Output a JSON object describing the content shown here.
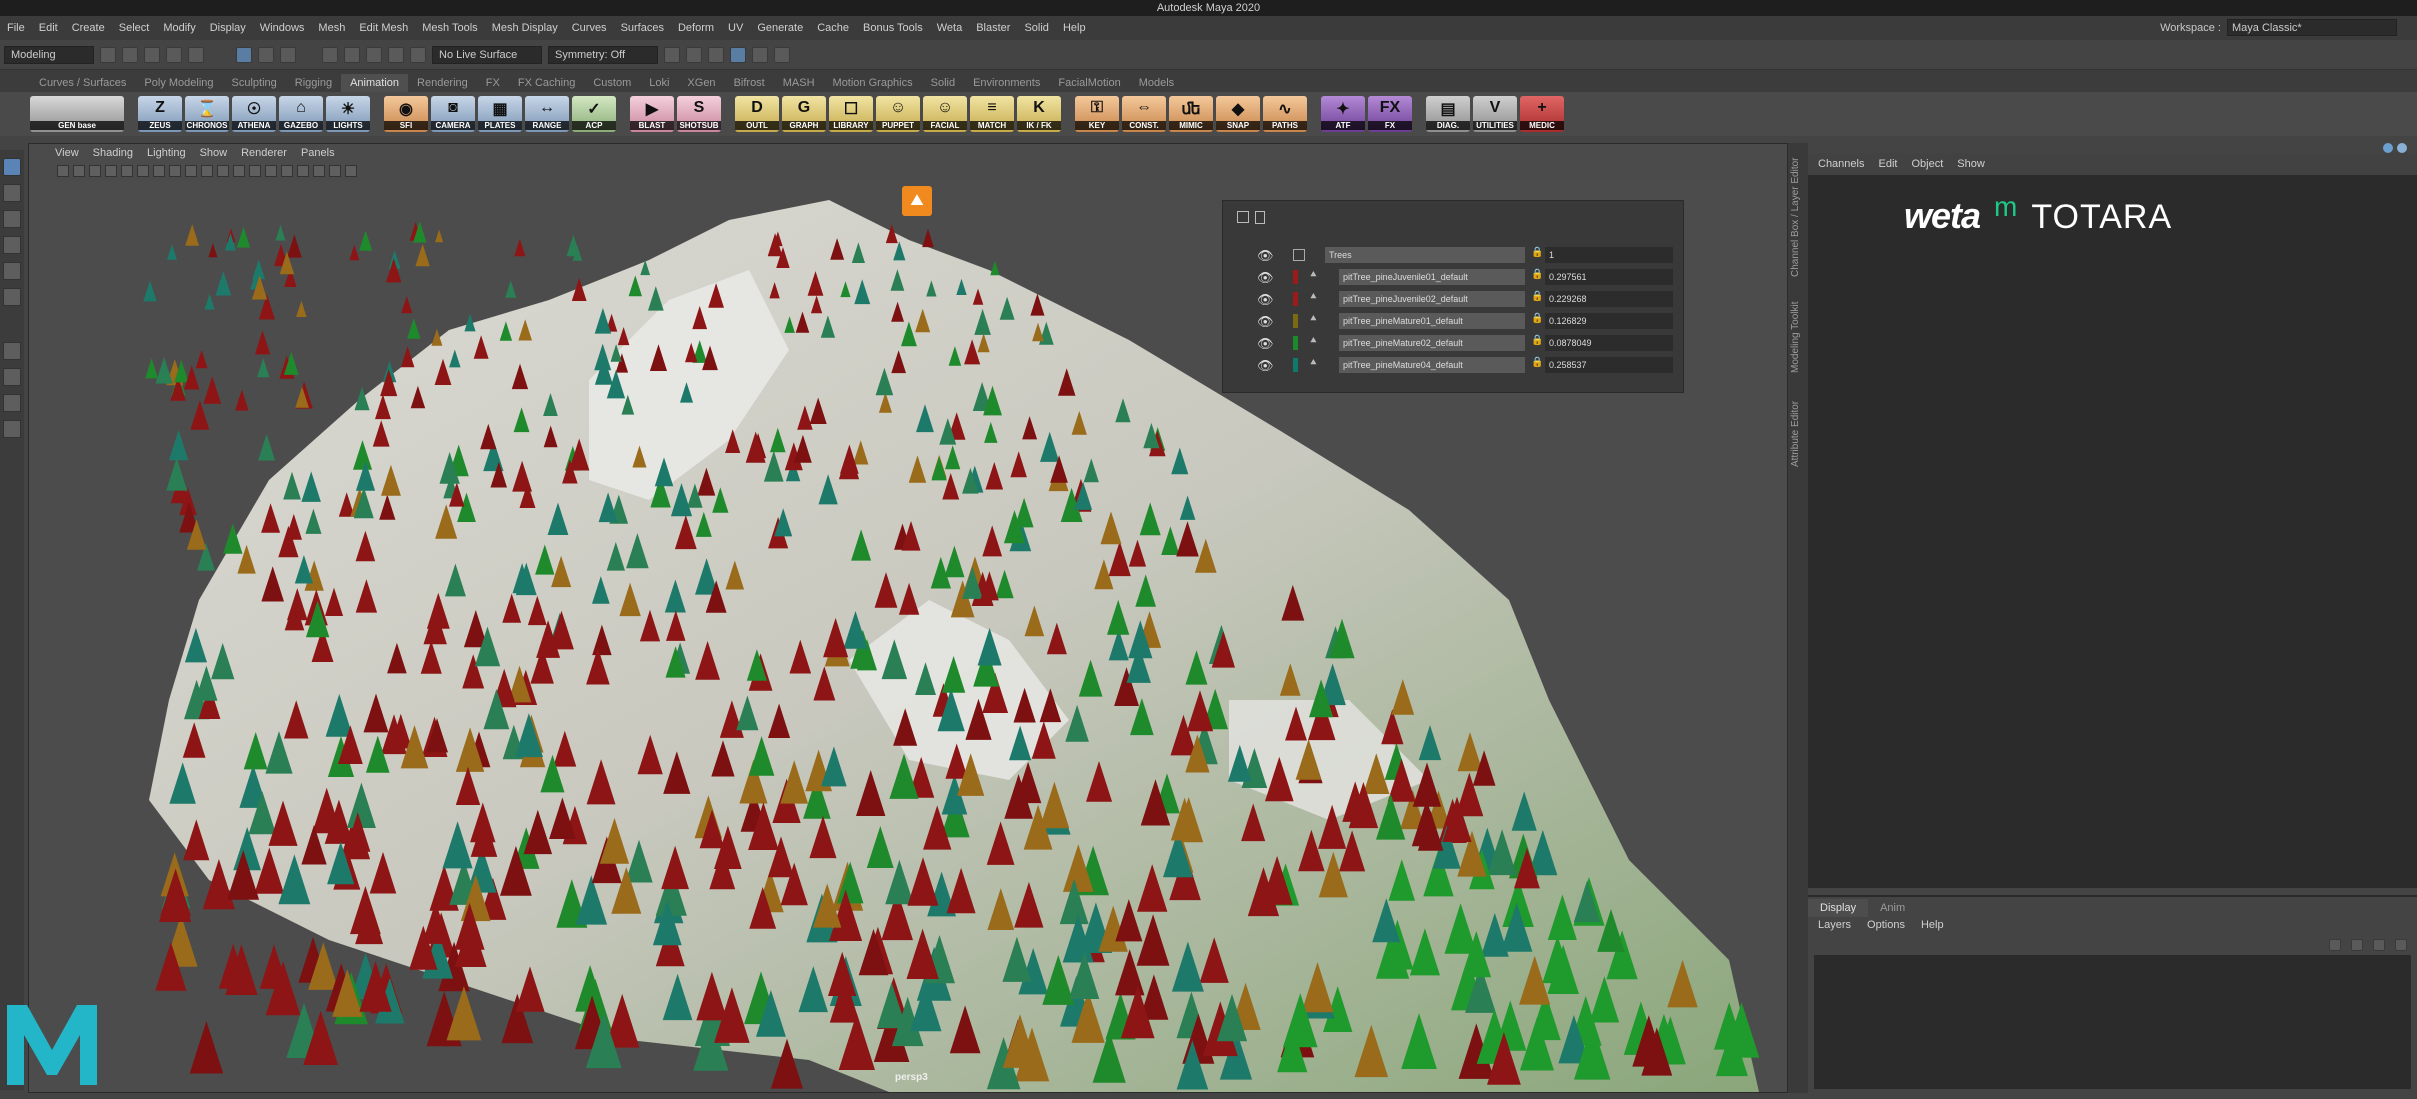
{
  "app_title": "Autodesk Maya 2020",
  "menu": [
    "File",
    "Edit",
    "Create",
    "Select",
    "Modify",
    "Display",
    "Windows",
    "Mesh",
    "Edit Mesh",
    "Mesh Tools",
    "Mesh Display",
    "Curves",
    "Surfaces",
    "Deform",
    "UV",
    "Generate",
    "Cache",
    "Bonus Tools",
    "Weta",
    "Blaster",
    "Solid",
    "Help"
  ],
  "workspace": {
    "label": "Workspace :",
    "value": "Maya Classic*"
  },
  "status": {
    "mode": "Modeling",
    "live_surface": "No Live Surface",
    "symmetry": "Symmetry: Off"
  },
  "shelf_tabs": [
    "Curves / Surfaces",
    "Poly Modeling",
    "Sculpting",
    "Rigging",
    "Animation",
    "Rendering",
    "FX",
    "FX Caching",
    "Custom",
    "Loki",
    "XGen",
    "Bifrost",
    "MASH",
    "Motion Graphics",
    "Solid",
    "Environments",
    "FacialMotion",
    "Models"
  ],
  "shelf_active": "Animation",
  "shelf_buttons": [
    {
      "label": "GEN base",
      "color": "wide",
      "glyph": ""
    },
    {
      "label": "ZEUS",
      "color": "blue",
      "glyph": "Z"
    },
    {
      "label": "CHRONOS",
      "color": "blue",
      "glyph": "⌛"
    },
    {
      "label": "ATHENA",
      "color": "blue",
      "glyph": "☉"
    },
    {
      "label": "GAZEBO",
      "color": "blue",
      "glyph": "⌂"
    },
    {
      "label": "LIGHTS",
      "color": "blue",
      "glyph": "☀"
    },
    {
      "label": "SFI",
      "color": "orange",
      "glyph": "◉"
    },
    {
      "label": "CAMERA",
      "color": "blue",
      "glyph": "◙"
    },
    {
      "label": "PLATES",
      "color": "blue",
      "glyph": "▦"
    },
    {
      "label": "RANGE",
      "color": "blue",
      "glyph": "↔"
    },
    {
      "label": "ACP",
      "color": "green",
      "glyph": "✓"
    },
    {
      "label": "BLAST",
      "color": "pink",
      "glyph": "▶"
    },
    {
      "label": "SHOTSUB",
      "color": "pink",
      "glyph": "S"
    },
    {
      "label": "OUTL",
      "color": "yellow",
      "glyph": "D"
    },
    {
      "label": "GRAPH",
      "color": "yellow",
      "glyph": "G"
    },
    {
      "label": "LIBRARY",
      "color": "yellow",
      "glyph": "☐"
    },
    {
      "label": "PUPPET",
      "color": "yellow",
      "glyph": "☺"
    },
    {
      "label": "FACIAL",
      "color": "yellow",
      "glyph": "☺"
    },
    {
      "label": "MATCH",
      "color": "yellow",
      "glyph": "≡"
    },
    {
      "label": "IK / FK",
      "color": "yellow",
      "glyph": "K"
    },
    {
      "label": "KEY",
      "color": "orange",
      "glyph": "⚿"
    },
    {
      "label": "CONST.",
      "color": "orange",
      "glyph": "⇔"
    },
    {
      "label": "MIMIC",
      "color": "orange",
      "glyph": "ﬔ"
    },
    {
      "label": "SNAP",
      "color": "orange",
      "glyph": "◆"
    },
    {
      "label": "PATHS",
      "color": "orange",
      "glyph": "∿"
    },
    {
      "label": "ATF",
      "color": "purple",
      "glyph": "✦"
    },
    {
      "label": "FX",
      "color": "purple",
      "glyph": "FX"
    },
    {
      "label": "DIAG.",
      "color": "grey",
      "glyph": "▤"
    },
    {
      "label": "UTILITIES",
      "color": "grey",
      "glyph": "V"
    },
    {
      "label": "MEDIC",
      "color": "red",
      "glyph": "+"
    }
  ],
  "viewport": {
    "menu": [
      "View",
      "Shading",
      "Lighting",
      "Show",
      "Renderer",
      "Panels"
    ],
    "camera": "persp3"
  },
  "tree_panel": {
    "root": {
      "name": "Trees",
      "value": "1"
    },
    "rows": [
      {
        "name": "pitTree_pineJuvenile01_default",
        "value": "0.297561",
        "color": "#9b1b1b"
      },
      {
        "name": "pitTree_pineJuvenile02_default",
        "value": "0.229268",
        "color": "#9b1b1b"
      },
      {
        "name": "pitTree_pineMature01_default",
        "value": "0.126829",
        "color": "#7a6a12"
      },
      {
        "name": "pitTree_pineMature02_default",
        "value": "0.0878049",
        "color": "#1a8a2a"
      },
      {
        "name": "pitTree_pineMature04_default",
        "value": "0.258537",
        "color": "#0f7a6a"
      }
    ]
  },
  "channel_box": {
    "menu": [
      "Channels",
      "Edit",
      "Object",
      "Show"
    ],
    "logo_weta": "weta",
    "logo_m": "m",
    "logo_totara": "TOTARA"
  },
  "side_labels": [
    "Channel Box / Layer Editor",
    "Modeling Toolkit",
    "Attribute Editor"
  ],
  "layer_editor": {
    "tabs": [
      "Display",
      "Anim"
    ],
    "menu": [
      "Layers",
      "Options",
      "Help"
    ]
  },
  "maya_logo": "M"
}
